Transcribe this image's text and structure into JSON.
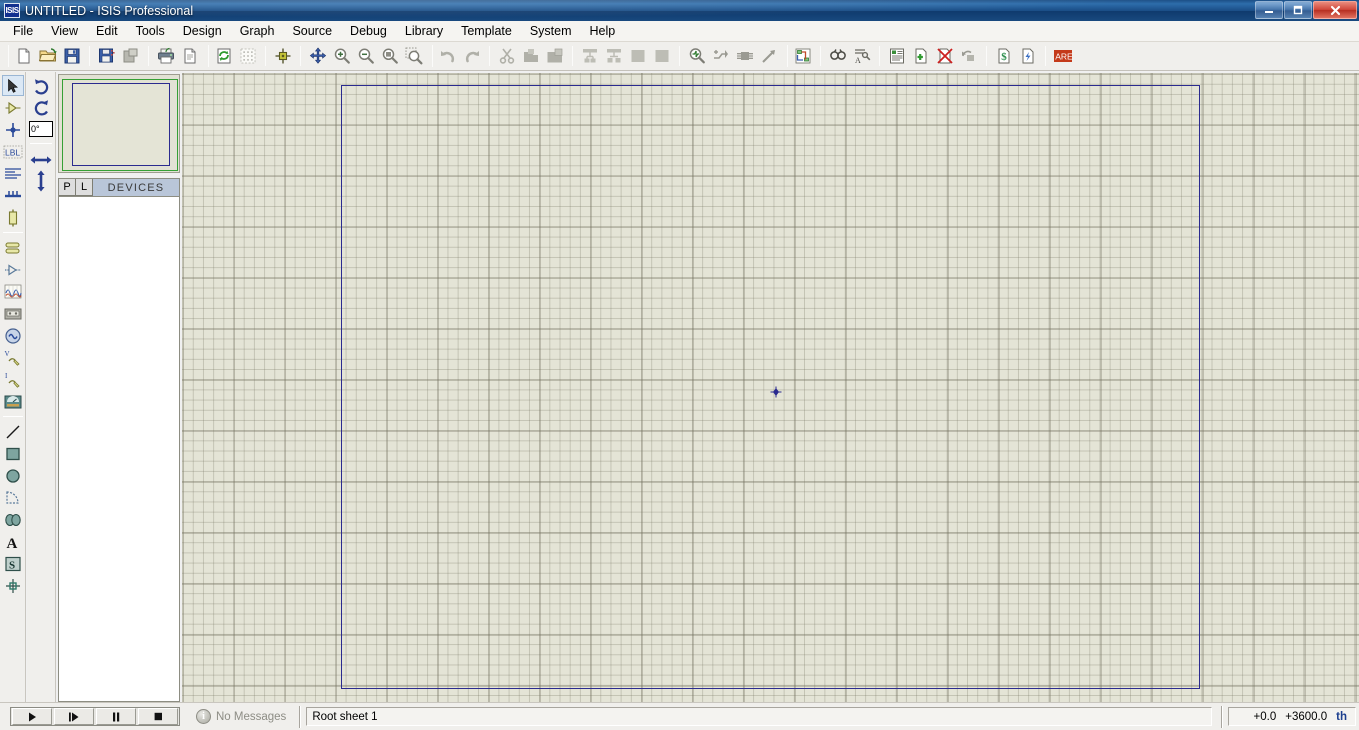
{
  "window": {
    "title": "UNTITLED - ISIS Professional",
    "app_icon_label": "ISIS",
    "minimize_glyph": "–",
    "maximize_glyph": "❐",
    "close_glyph": "✕"
  },
  "menu": {
    "items": [
      {
        "label": "File",
        "name": "menu-file"
      },
      {
        "label": "View",
        "name": "menu-view"
      },
      {
        "label": "Edit",
        "name": "menu-edit"
      },
      {
        "label": "Tools",
        "name": "menu-tools"
      },
      {
        "label": "Design",
        "name": "menu-design"
      },
      {
        "label": "Graph",
        "name": "menu-graph"
      },
      {
        "label": "Source",
        "name": "menu-source"
      },
      {
        "label": "Debug",
        "name": "menu-debug"
      },
      {
        "label": "Library",
        "name": "menu-library"
      },
      {
        "label": "Template",
        "name": "menu-template"
      },
      {
        "label": "System",
        "name": "menu-system"
      },
      {
        "label": "Help",
        "name": "menu-help"
      }
    ]
  },
  "toolbar": {
    "groups": [
      {
        "icons": [
          "new-file-icon",
          "open-folder-icon",
          "save-icon"
        ]
      },
      {
        "icons": [
          "save-as-icon",
          "import-section-icon"
        ]
      },
      {
        "icons": [
          "print-icon",
          "print-region-icon"
        ]
      },
      {
        "icons": [
          "refresh-display-icon",
          "toggle-grid-icon",
          "origin-icon"
        ]
      },
      {
        "icons": [
          "pan-icon",
          "zoom-in-icon",
          "zoom-out-icon",
          "zoom-sheet-icon",
          "zoom-area-icon"
        ]
      },
      {
        "icons": [
          "undo-icon",
          "redo-icon"
        ]
      },
      {
        "icons": [
          "cut-icon",
          "copy-icon",
          "paste-icon"
        ]
      },
      {
        "icons": [
          "block-copy-icon",
          "block-move-icon",
          "block-rotate-icon",
          "block-delete-icon"
        ]
      },
      {
        "icons": [
          "pick-device-icon",
          "make-device-icon",
          "packaging-tool-icon",
          "decompose-icon"
        ]
      },
      {
        "icons": [
          "wire-autorouter-icon"
        ]
      },
      {
        "icons": [
          "search-tag-icon",
          "property-assignment-icon"
        ]
      },
      {
        "icons": [
          "design-explorer-icon",
          "new-sheet-icon",
          "remove-sheet-icon",
          "exit-sheet-icon"
        ]
      },
      {
        "icons": [
          "bill-of-materials-icon",
          "electrical-rules-check-icon"
        ]
      },
      {
        "icons": [
          "netlist-to-ares-icon"
        ]
      }
    ]
  },
  "left_tools": {
    "items": [
      {
        "name": "selection-mode-tool",
        "icon": "arrow-cursor-icon",
        "active": true
      },
      {
        "name": "component-mode-tool",
        "icon": "component-icon",
        "active": false
      },
      {
        "name": "junction-dot-tool",
        "icon": "junction-dot-icon",
        "active": false
      },
      {
        "name": "wire-label-tool",
        "icon": "label-icon",
        "active": false
      },
      {
        "name": "text-script-tool",
        "icon": "text-script-icon",
        "active": false
      },
      {
        "name": "buses-tool",
        "icon": "bus-icon",
        "active": false
      },
      {
        "name": "subcircuit-tool",
        "icon": "subcircuit-icon",
        "active": false
      },
      {
        "name": "terminals-mode-tool",
        "icon": "terminal-icon",
        "active": false
      },
      {
        "name": "device-pins-tool",
        "icon": "device-pin-icon",
        "active": false
      },
      {
        "name": "graph-mode-tool",
        "icon": "graph-icon",
        "active": false
      },
      {
        "name": "tape-recorder-tool",
        "icon": "tape-recorder-icon",
        "active": false
      },
      {
        "name": "generator-mode-tool",
        "icon": "generator-icon",
        "active": false
      },
      {
        "name": "voltage-probe-tool",
        "icon": "voltage-probe-icon",
        "active": false
      },
      {
        "name": "current-probe-tool",
        "icon": "current-probe-icon",
        "active": false
      },
      {
        "name": "virtual-instruments-tool",
        "icon": "instrument-icon",
        "active": false
      },
      {
        "name": "2d-line-tool",
        "icon": "line-icon",
        "active": false
      },
      {
        "name": "2d-box-tool",
        "icon": "box-icon",
        "active": false
      },
      {
        "name": "2d-circle-tool",
        "icon": "circle-icon",
        "active": false
      },
      {
        "name": "2d-arc-tool",
        "icon": "arc-icon",
        "active": false
      },
      {
        "name": "2d-path-tool",
        "icon": "path-icon",
        "active": false
      },
      {
        "name": "2d-text-tool",
        "icon": "text-a-icon",
        "active": false
      },
      {
        "name": "2d-symbol-tool",
        "icon": "symbol-s-icon",
        "active": false
      },
      {
        "name": "2d-marker-tool",
        "icon": "marker-icon",
        "active": false
      }
    ]
  },
  "rotation": {
    "clockwise_name": "rotate-clockwise-button",
    "anticlockwise_name": "rotate-anticlockwise-button",
    "angle_value": "0°",
    "mirror_x_name": "mirror-horizontal-button",
    "mirror_y_name": "mirror-vertical-button"
  },
  "devices_panel": {
    "tab_p": "P",
    "tab_l": "L",
    "title": "DEVICES",
    "items": []
  },
  "canvas": {
    "sheet_name": "Root sheet 1",
    "grid_color": "#e4e4d6",
    "sheet_border_color": "#2b2b8f"
  },
  "statusbar": {
    "animation_controls": [
      {
        "name": "play-button",
        "glyph": "▶"
      },
      {
        "name": "step-button",
        "glyph": "▶❙"
      },
      {
        "name": "pause-button",
        "glyph": "❙❙"
      },
      {
        "name": "stop-button",
        "glyph": "■"
      }
    ],
    "message_text": "No Messages",
    "message_icon": "info-icon",
    "sheet_field_value": "Root sheet 1",
    "coord_x": "+0.0",
    "coord_y": "+3600.0",
    "coord_units": "th"
  }
}
